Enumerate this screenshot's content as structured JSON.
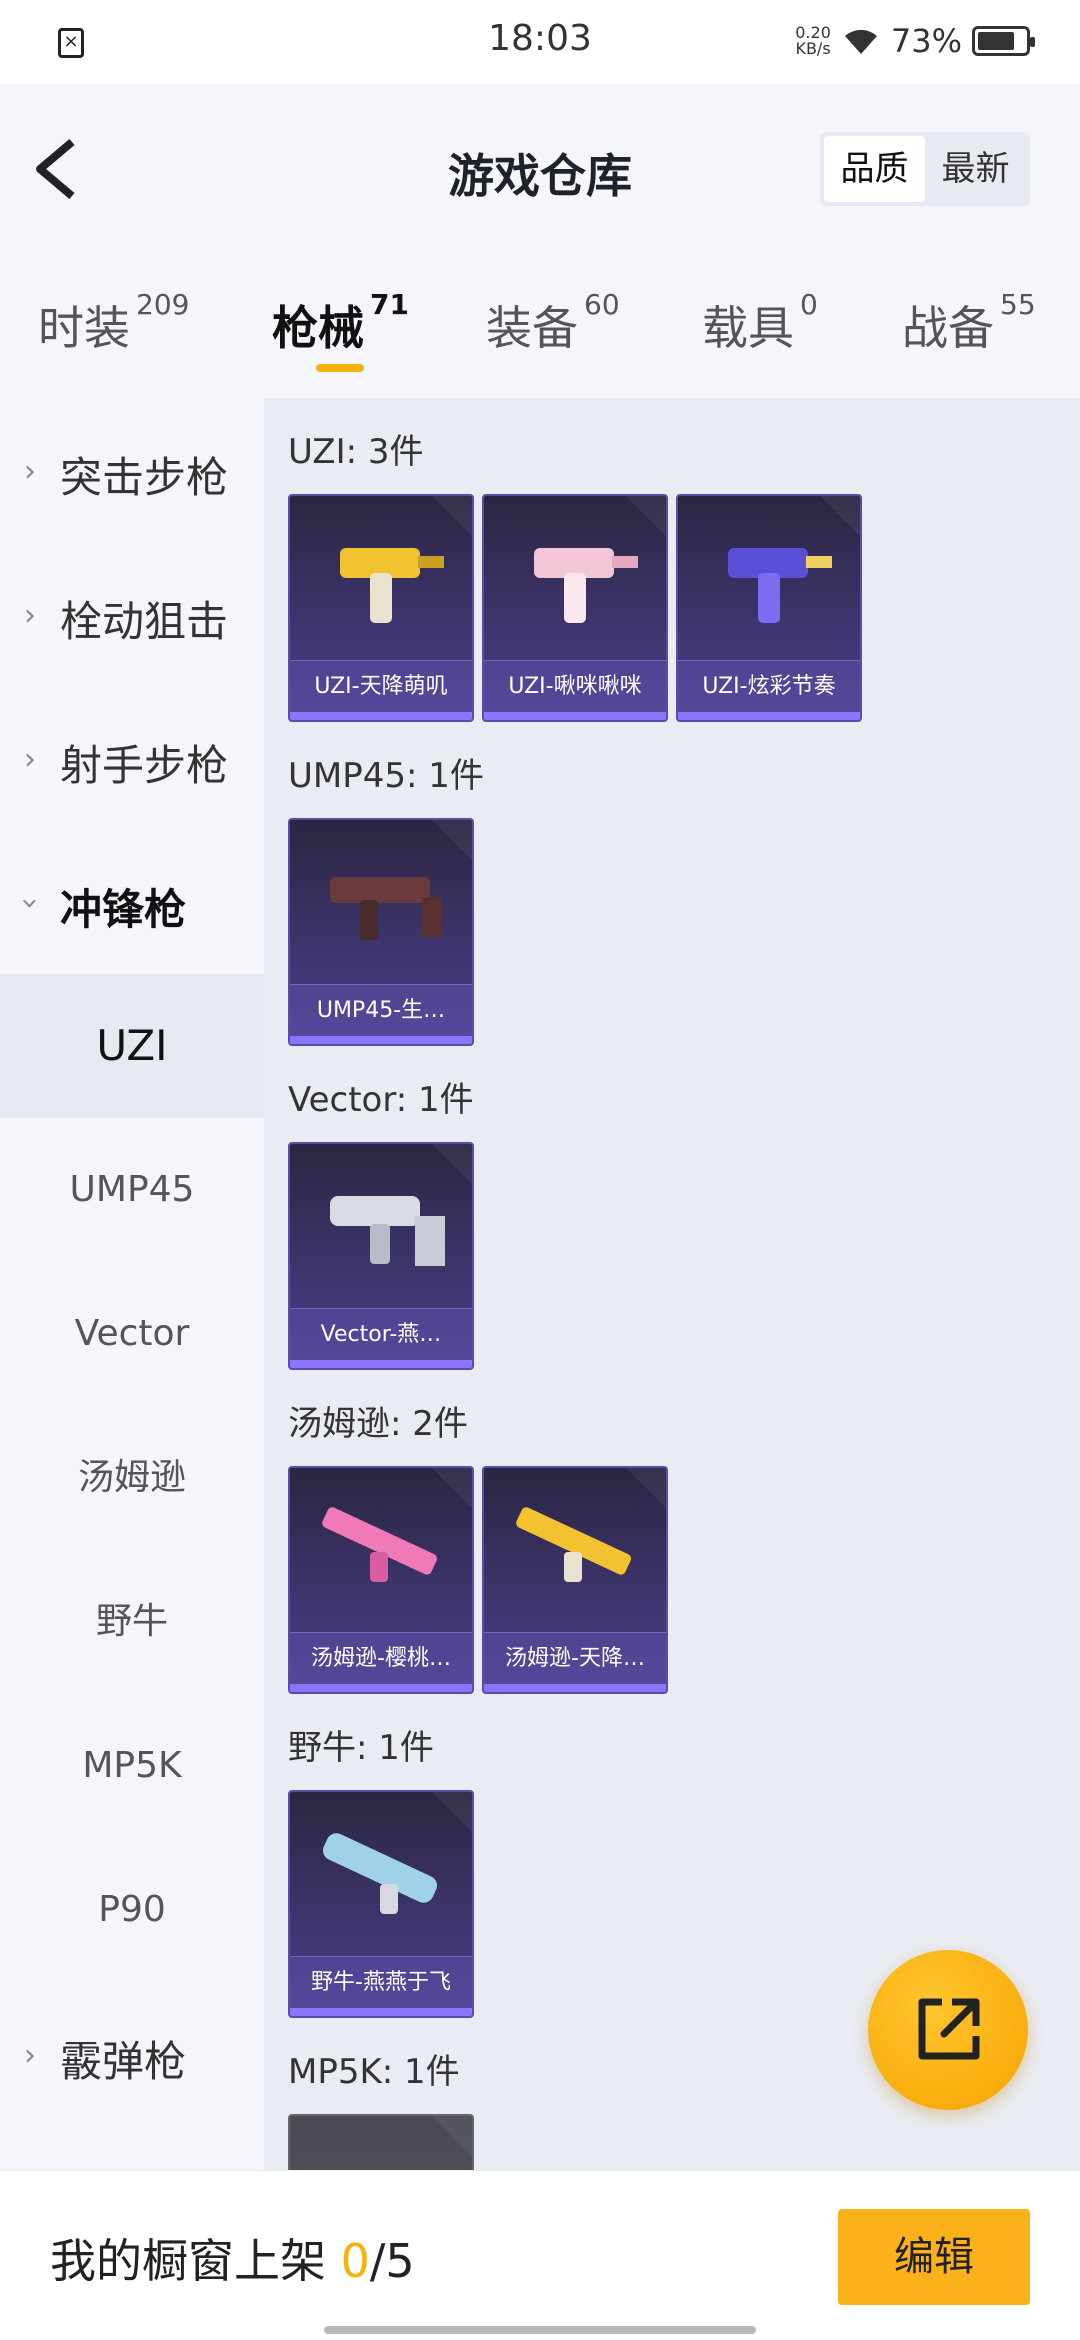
{
  "status_bar": {
    "time": "18:03",
    "speed_value": "0.20",
    "speed_unit": "KB/s",
    "battery": "73%"
  },
  "header": {
    "title": "游戏仓库",
    "sort": {
      "quality": "品质",
      "latest": "最新"
    }
  },
  "tabs": [
    {
      "label": "时装",
      "count": "209"
    },
    {
      "label": "枪械",
      "count": "71"
    },
    {
      "label": "装备",
      "count": "60"
    },
    {
      "label": "载具",
      "count": "0"
    },
    {
      "label": "战备",
      "count": "55"
    }
  ],
  "sidebar": {
    "groups": [
      {
        "label": "突击步枪"
      },
      {
        "label": "栓动狙击"
      },
      {
        "label": "射手步枪"
      },
      {
        "label": "冲锋枪"
      },
      {
        "label": "霰弹枪"
      }
    ],
    "subs": [
      "UZI",
      "UMP45",
      "Vector",
      "汤姆逊",
      "野牛",
      "MP5K",
      "P90"
    ]
  },
  "sections": [
    {
      "title": "UZI: 3件",
      "items": [
        "UZI-天降萌叽",
        "UZI-啾咪啾咪",
        "UZI-炫彩节奏"
      ]
    },
    {
      "title": "UMP45: 1件",
      "items": [
        "UMP45-生…"
      ]
    },
    {
      "title": "Vector: 1件",
      "items": [
        "Vector-燕…"
      ]
    },
    {
      "title": "汤姆逊: 2件",
      "items": [
        "汤姆逊-樱桃…",
        "汤姆逊-天降…"
      ]
    },
    {
      "title": "野牛: 1件",
      "items": [
        "野牛-燕燕于飞"
      ]
    },
    {
      "title": "MP5K: 1件",
      "items": []
    }
  ],
  "bottom": {
    "label": "我的橱窗上架 ",
    "current": "0",
    "total": "/5",
    "edit": "编辑"
  },
  "colors": {
    "accent": "#f5b10c",
    "card_bg": "#3f3570",
    "content_bg": "#e9ecf2"
  },
  "icons": {
    "back": "chevron-left-icon",
    "fab": "share-external-icon"
  }
}
